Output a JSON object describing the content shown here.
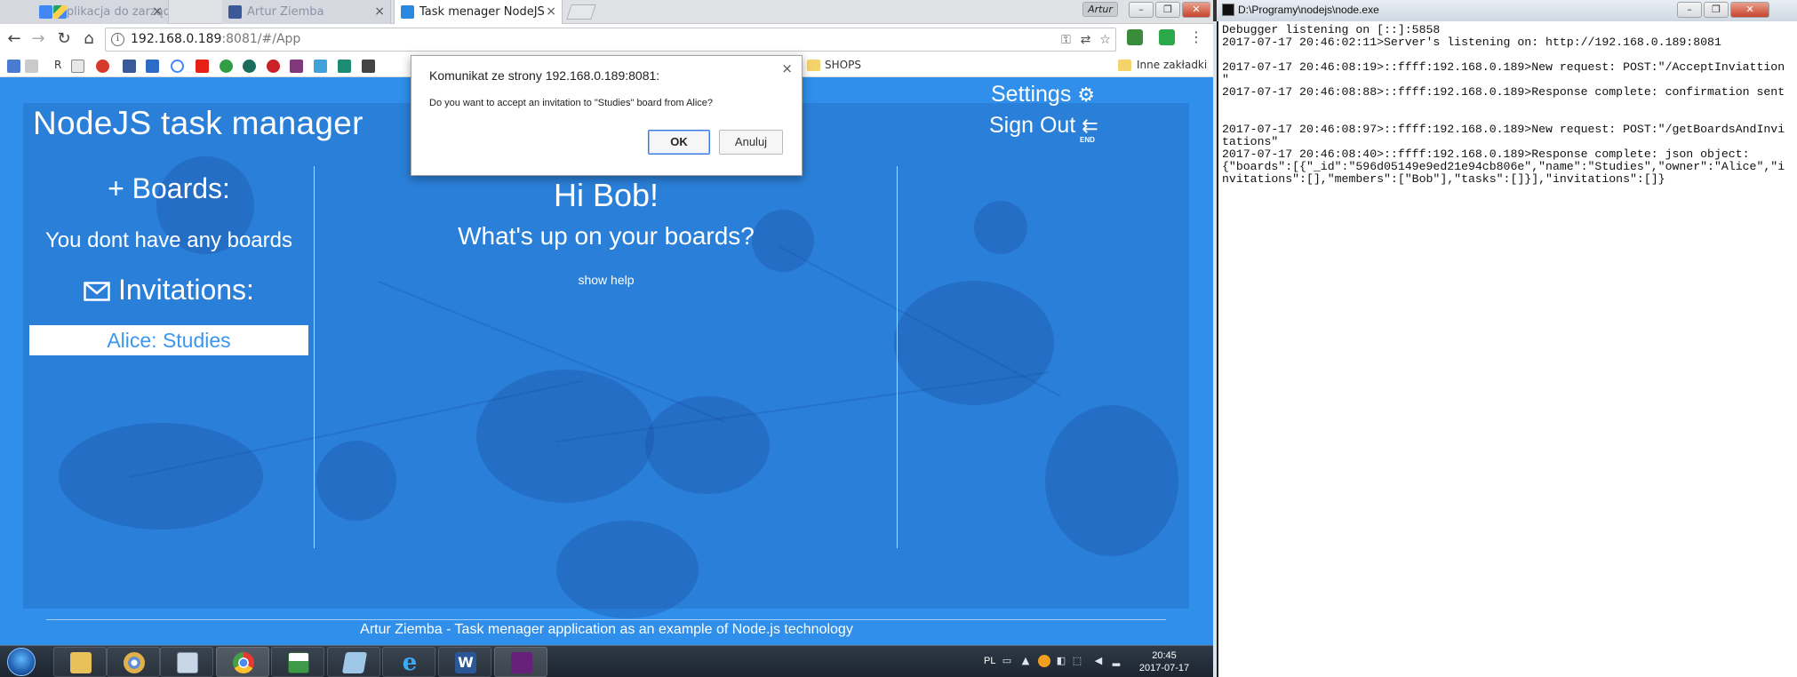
{
  "browser": {
    "tabs": [
      {
        "label": "Aplikacja do zarządzania",
        "active": false
      },
      {
        "label": "Artur Ziemba",
        "active": false
      },
      {
        "label": "Task menager NodeJS",
        "active": true
      }
    ],
    "profile_name": "Artur",
    "address": {
      "host": "192.168.0.189",
      "rest": ":8081/#/App"
    },
    "bookmarks": {
      "shops_label": "SHOPS",
      "other_label": "Inne zakładki",
      "letter_r": "R"
    }
  },
  "app": {
    "title": "NodeJS task manager",
    "boards_heading": "+ Boards:",
    "no_boards_text": "You dont have any boards",
    "invitations_heading": "Invitations:",
    "invitation_item": "Alice: Studies",
    "greeting": "Hi Bob!",
    "subheading": "What's up on your boards?",
    "help_link": "show help",
    "menu": {
      "settings": "Settings",
      "signout": "Sign Out",
      "signout_badge": "END"
    },
    "footer": "Artur Ziemba - Task menager application as an example of Node.js technology"
  },
  "dialog": {
    "title": "Komunikat ze strony 192.168.0.189:8081:",
    "message": "Do you want to accept an invitation to \"Studies\" board from Alice?",
    "ok_label": "OK",
    "cancel_label": "Anuluj"
  },
  "console": {
    "title": "D:\\Programy\\nodejs\\node.exe",
    "lines": [
      "Debugger listening on [::]:5858",
      "2017-07-17 20:46:02:11>Server's listening on: http://192.168.0.189:8081",
      "",
      "2017-07-17 20:46:08:19>::ffff:192.168.0.189>New request: POST:\"/AcceptInviattion",
      "\"",
      "2017-07-17 20:46:08:88>::ffff:192.168.0.189>Response complete: confirmation sent",
      "",
      "",
      "2017-07-17 20:46:08:97>::ffff:192.168.0.189>New request: POST:\"/getBoardsAndInvi",
      "tations\"",
      "2017-07-17 20:46:08:40>::ffff:192.168.0.189>Response complete: json object:",
      "{\"boards\":[{\"_id\":\"596d05149e9ed21e94cb806e\",\"name\":\"Studies\",\"owner\":\"Alice\",\"i",
      "nvitations\":[],\"members\":[\"Bob\"],\"tasks\":[]}],\"invitations\":[]}"
    ]
  },
  "taskbar": {
    "language": "PL",
    "time": "20:45",
    "date": "2017-07-17"
  },
  "colors": {
    "page_bg": "#2f8fea",
    "panel_bg": "#2a7fd8",
    "accent_text": "#3b96ee",
    "dialog_ok_border": "#3b78e7"
  }
}
